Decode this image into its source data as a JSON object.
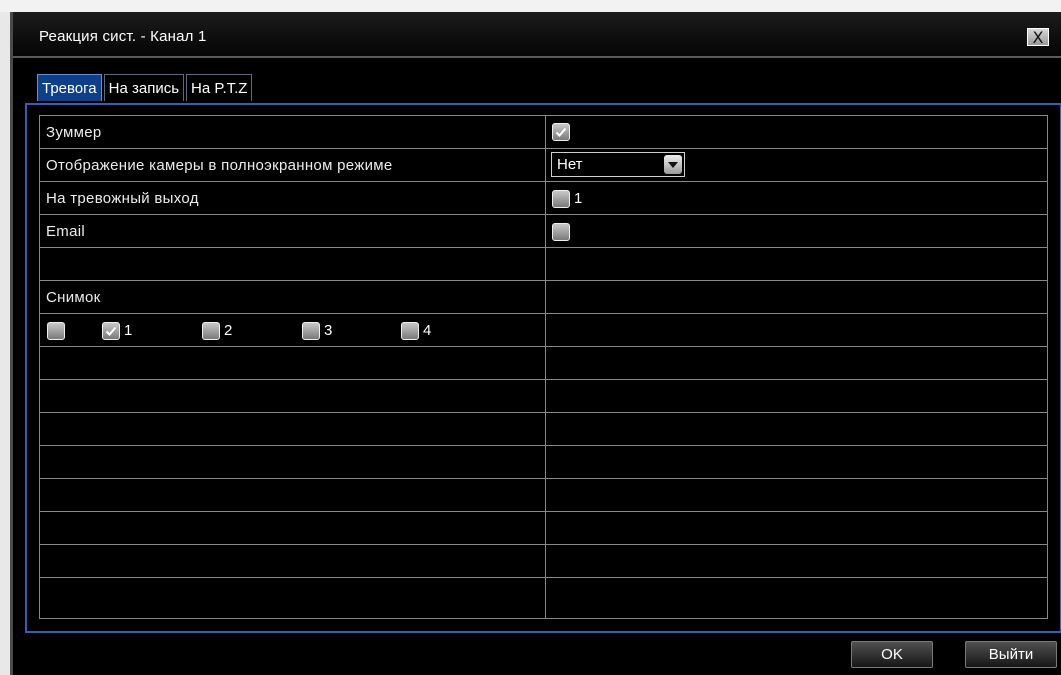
{
  "window": {
    "title": "Реакция сист. - Канал 1",
    "close_label": "X"
  },
  "tabs": [
    {
      "label": "Тревога",
      "active": true
    },
    {
      "label": "На запись",
      "active": false
    },
    {
      "label": "На P.T.Z",
      "active": false
    }
  ],
  "alarm": {
    "buzzer": {
      "label": "Зуммер",
      "checked": true
    },
    "fullscreen": {
      "label": "Отображение камеры в полноэкранном режиме",
      "value": "Нет"
    },
    "alarm_out": {
      "label": "На тревожный выход",
      "option": "1",
      "checked": false
    },
    "email": {
      "label": "Email",
      "checked": false
    },
    "snapshot": {
      "label": "Снимок",
      "all_checked": false,
      "channels": [
        {
          "label": "1",
          "checked": true
        },
        {
          "label": "2",
          "checked": false
        },
        {
          "label": "3",
          "checked": false
        },
        {
          "label": "4",
          "checked": false
        }
      ]
    }
  },
  "buttons": {
    "ok": "OK",
    "exit": "Выйти"
  }
}
